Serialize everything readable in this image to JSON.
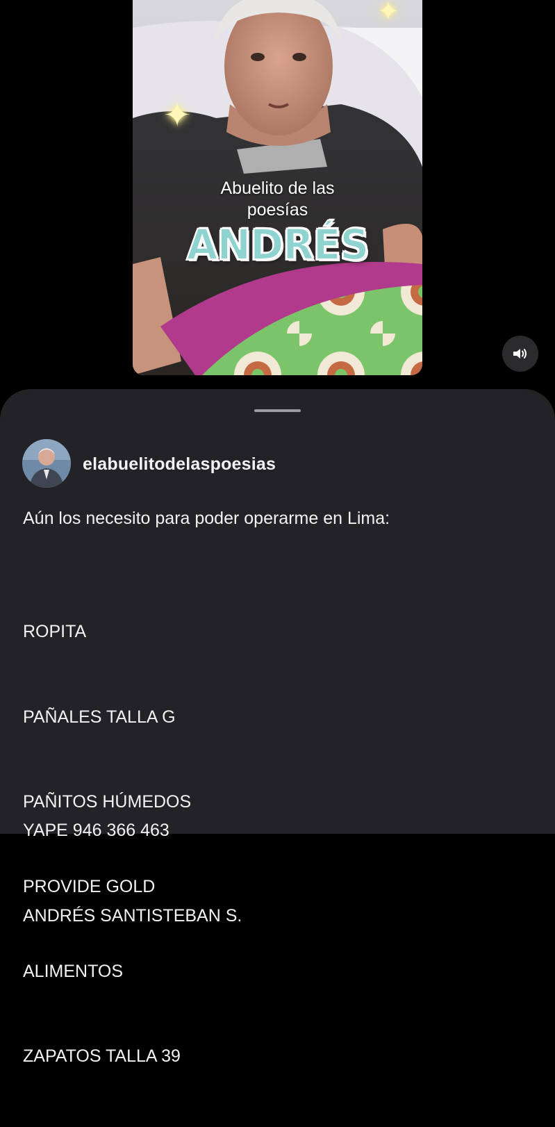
{
  "video": {
    "overlay_subtitle_line1": "Abuelito de las",
    "overlay_subtitle_line2": "poesías",
    "overlay_title": "ANDRÉS",
    "title_color": "#8fd3d1",
    "sparkle_icon": "✦",
    "sound_button_icon": "speaker-volume-icon"
  },
  "post": {
    "username": "elabuelitodelaspoesias",
    "caption_intro": "Aún los necesito para poder operarme en Lima:",
    "needs_list": [
      "ROPITA",
      "PAÑALES TALLA G",
      "PAÑITOS HÚMEDOS",
      "PROVIDE GOLD",
      "ALIMENTOS",
      "ZAPATOS TALLA 39"
    ],
    "payment_line": "YAPE 946 366 463",
    "recipient_name": "ANDRÉS SANTISTEBAN S."
  },
  "colors": {
    "background": "#000000",
    "sheet": "#232327",
    "text": "#f2f2f4",
    "handle": "#9a9aa0"
  }
}
